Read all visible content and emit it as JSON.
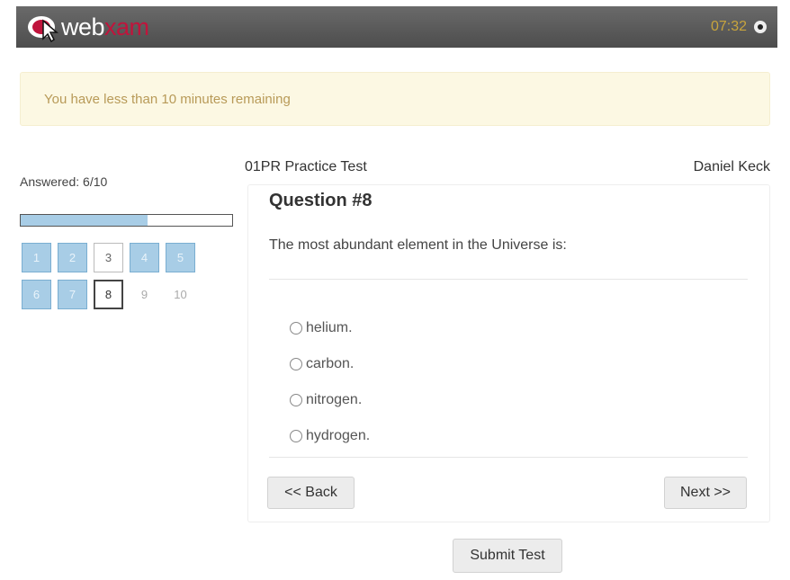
{
  "header": {
    "logo_web": "web",
    "logo_xam": "xam",
    "timer": "07:32",
    "timer_icon": "eye-icon"
  },
  "alert": {
    "text": "You have less than 10 minutes remaining"
  },
  "sidebar": {
    "answered_label": "Answered: 6/10",
    "progress_fraction": 0.6,
    "questions": [
      {
        "label": "1",
        "state": "answered"
      },
      {
        "label": "2",
        "state": "answered"
      },
      {
        "label": "3",
        "state": "unanswered"
      },
      {
        "label": "4",
        "state": "answered"
      },
      {
        "label": "5",
        "state": "answered"
      },
      {
        "label": "6",
        "state": "answered"
      },
      {
        "label": "7",
        "state": "answered"
      },
      {
        "label": "8",
        "state": "current"
      },
      {
        "label": "9",
        "state": "unvisited"
      },
      {
        "label": "10",
        "state": "unvisited"
      }
    ]
  },
  "test": {
    "name": "01PR Practice Test",
    "user": "Daniel Keck"
  },
  "question": {
    "title": "Question #8",
    "text": "The most abundant element in the Universe is:",
    "options": [
      "helium.",
      "carbon.",
      "nitrogen.",
      "hydrogen."
    ]
  },
  "nav": {
    "back_label": "<< Back",
    "next_label": "Next >>",
    "submit_label": "Submit Test"
  },
  "colors": {
    "header_bg": "#5a5a5a",
    "brand_red": "#c0143c",
    "timer": "#c8a43c",
    "alert_bg": "#fcf8e3",
    "answered_fill": "#a8cde6"
  }
}
